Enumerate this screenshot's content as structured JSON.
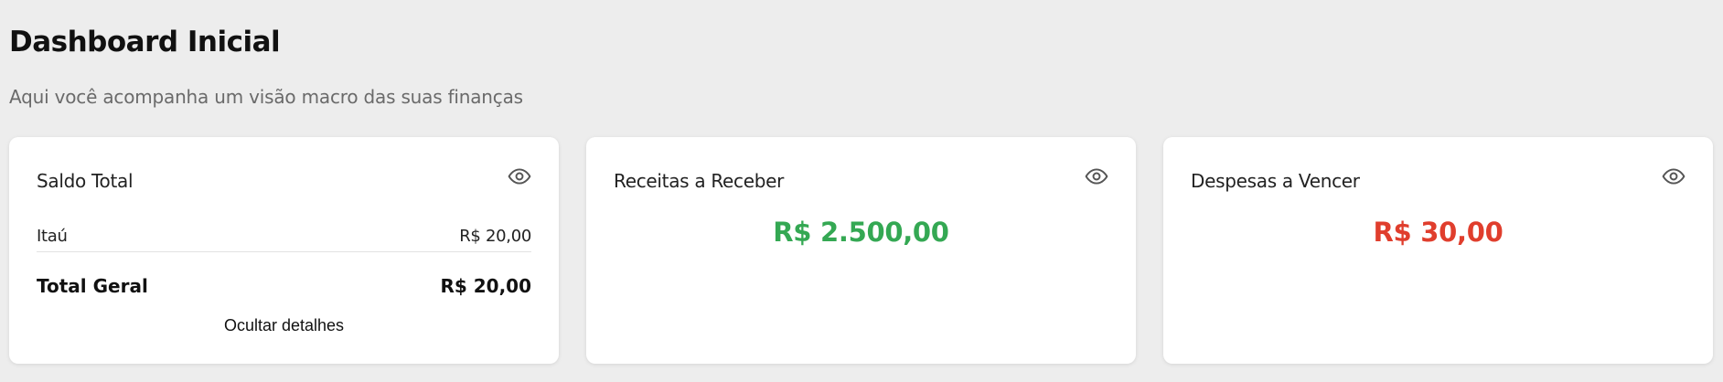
{
  "header": {
    "title": "Dashboard Inicial",
    "subtitle": "Aqui você acompanha um visão macro das suas finanças"
  },
  "cards": {
    "saldo": {
      "title": "Saldo Total",
      "icon": "eye-icon",
      "accounts": [
        {
          "name": "Itaú",
          "value": "R$ 20,00"
        }
      ],
      "total_label": "Total Geral",
      "total_value": "R$ 20,00",
      "toggle_label": "Ocultar detalhes"
    },
    "receitas": {
      "title": "Receitas a Receber",
      "icon": "eye-icon",
      "value": "R$ 2.500,00",
      "color": "#34a853"
    },
    "despesas": {
      "title": "Despesas a Vencer",
      "icon": "eye-icon",
      "value": "R$ 30,00",
      "color": "#e03e2d"
    }
  }
}
